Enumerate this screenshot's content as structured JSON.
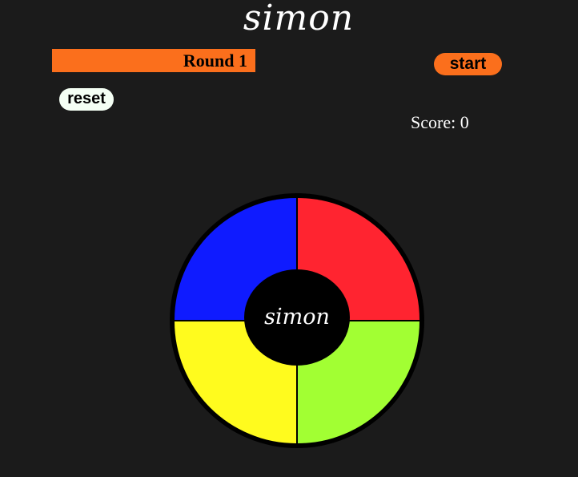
{
  "header": {
    "title": "simon"
  },
  "controls": {
    "round_label": "Round 1",
    "start_label": "start",
    "reset_label": "reset",
    "score_label": "Score:",
    "score_value": "0"
  },
  "board": {
    "center_label": "simon",
    "pads": [
      {
        "name": "blue",
        "color": "#0f1bff"
      },
      {
        "name": "red",
        "color": "#ff2430"
      },
      {
        "name": "yellow",
        "color": "#fffb1e"
      },
      {
        "name": "green",
        "color": "#a2ff33"
      }
    ]
  },
  "colors": {
    "background": "#1b1b1b",
    "accent": "#fb6f1c",
    "reset_button": "#f4fff4"
  }
}
